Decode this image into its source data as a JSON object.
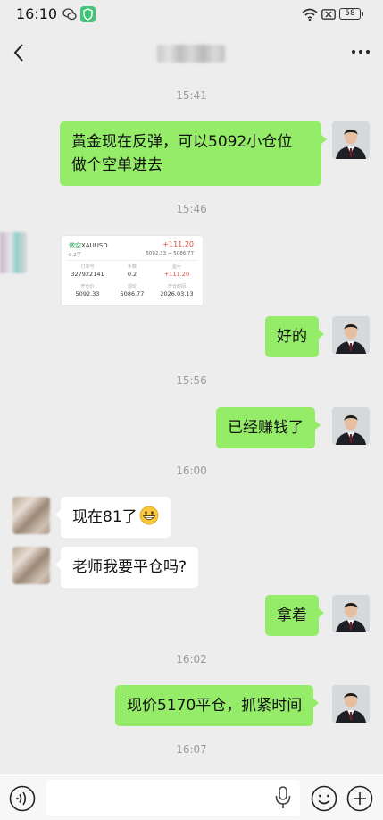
{
  "status_bar": {
    "time": "16:10",
    "battery": "58",
    "icons": [
      "wechat-icon",
      "shield-icon",
      "wifi-icon",
      "sim-off-icon",
      "battery-icon"
    ]
  },
  "nav": {
    "contact_name_blurred": true,
    "icons": [
      "back-icon",
      "more-icon"
    ]
  },
  "messages": [
    {
      "type": "timestamp",
      "text": "15:41"
    },
    {
      "type": "text",
      "from": "me",
      "lines": [
        "黄金现在反弹，可以5092小仓位",
        "做个空单进去"
      ]
    },
    {
      "type": "timestamp",
      "text": "15:46"
    },
    {
      "type": "image",
      "from": "other",
      "trade_card": {
        "tag": "做空",
        "symbol": "XAUUSD",
        "profit": "+111.20",
        "lots": "0.2手",
        "price_range": "5092.33 → 5086.77",
        "row1": [
          {
            "label": "订单号",
            "value": "327922141"
          },
          {
            "label": "手数",
            "value": "0.2"
          },
          {
            "label": "盈亏",
            "value": "+111.20"
          }
        ],
        "row2": [
          {
            "label": "开仓价",
            "value": "5092.33"
          },
          {
            "label": "现价",
            "value": "5086.77"
          },
          {
            "label": "开仓时间",
            "value": "2026.03.13"
          }
        ]
      }
    },
    {
      "type": "text",
      "from": "me",
      "lines": [
        "好的"
      ]
    },
    {
      "type": "timestamp",
      "text": "15:56"
    },
    {
      "type": "text",
      "from": "me",
      "lines": [
        "已经赚钱了"
      ]
    },
    {
      "type": "timestamp",
      "text": "16:00"
    },
    {
      "type": "text",
      "from": "other",
      "lines": [
        "现在81了"
      ],
      "emoji": "grinning-face-icon"
    },
    {
      "type": "text",
      "from": "other",
      "lines": [
        "老师我要平仓吗?"
      ]
    },
    {
      "type": "text",
      "from": "me",
      "lines": [
        "拿着"
      ]
    },
    {
      "type": "timestamp",
      "text": "16:02"
    },
    {
      "type": "text",
      "from": "me",
      "lines": [
        "现价5170平仓，抓紧时间"
      ]
    },
    {
      "type": "timestamp",
      "text": "16:07"
    }
  ],
  "bottom_bar": {
    "input_value": "",
    "icons": [
      "voice-icon",
      "mic-icon",
      "emoji-icon",
      "plus-icon"
    ]
  },
  "colors": {
    "background": "#ededed",
    "my_bubble": "#95ec69",
    "their_bubble": "#ffffff",
    "timestamp": "#9b9b9b",
    "profit": "#e0483c",
    "short_tag": "#2aa05b"
  }
}
